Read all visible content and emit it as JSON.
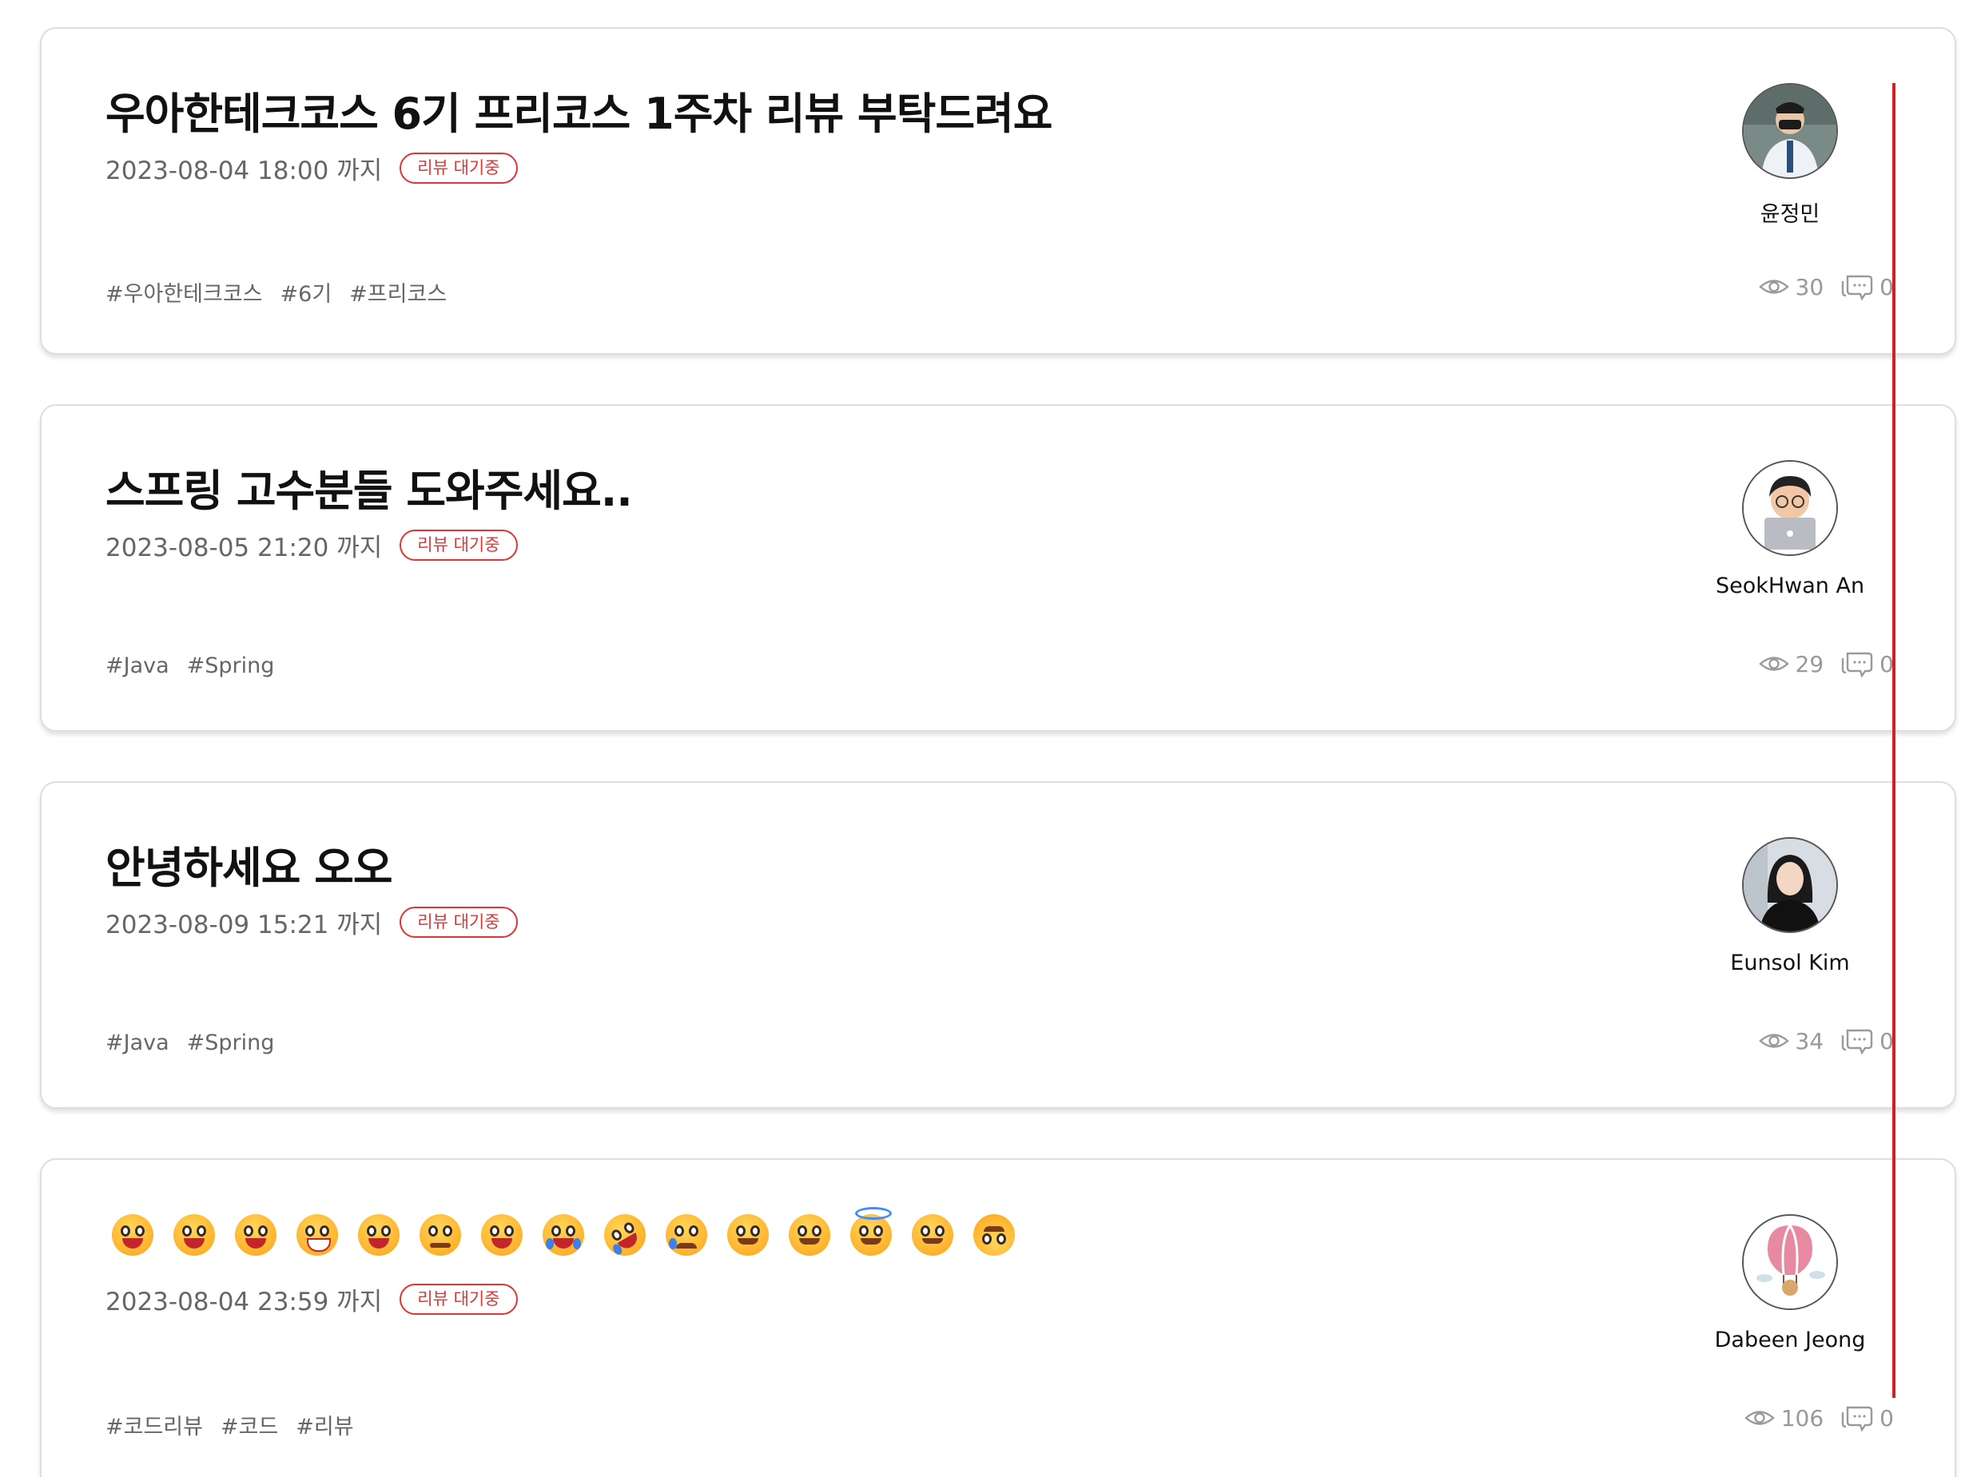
{
  "colors": {
    "status_red": "#e03535",
    "text_muted": "#666666",
    "stat_gray": "#999999",
    "indicator_red": "#d61f1f"
  },
  "posts": [
    {
      "title": "우아한테크코스 6기 프리코스 1주차 리뷰 부탁드려요",
      "deadline": "2023-08-04 18:00 까지",
      "status": "리뷰 대기중",
      "tags": [
        "#우아한테크코스",
        "#6기",
        "#프리코스"
      ],
      "author": "윤정민",
      "views": "30",
      "comments": "0"
    },
    {
      "title": "스프링 고수분들 도와주세요..",
      "deadline": "2023-08-05 21:20 까지",
      "status": "리뷰 대기중",
      "tags": [
        "#Java",
        "#Spring"
      ],
      "author": "SeokHwan An",
      "views": "29",
      "comments": "0"
    },
    {
      "title": "안녕하세요 오오",
      "deadline": "2023-08-09 15:21 까지",
      "status": "리뷰 대기중",
      "tags": [
        "#Java",
        "#Spring"
      ],
      "author": "Eunsol Kim",
      "views": "34",
      "comments": "0"
    },
    {
      "title_emojis": [
        "grinning-face",
        "grinning-face-big-eyes",
        "grinning-face-smiling-eyes",
        "beaming-face",
        "grinning-squinting-face",
        "pleading-face",
        "grinning-face-sweat",
        "face-with-tears-of-joy",
        "rolling-on-floor-laughing",
        "crying-face",
        "smiling-face-blush",
        "smiling-face-smiling-eyes",
        "smiling-face-halo",
        "slightly-smiling-face",
        "upside-down-face"
      ],
      "deadline": "2023-08-04 23:59 까지",
      "status": "리뷰 대기중",
      "tags": [
        "#코드리뷰",
        "#코드",
        "#리뷰"
      ],
      "author": "Dabeen Jeong",
      "views": "106",
      "comments": "0"
    }
  ]
}
